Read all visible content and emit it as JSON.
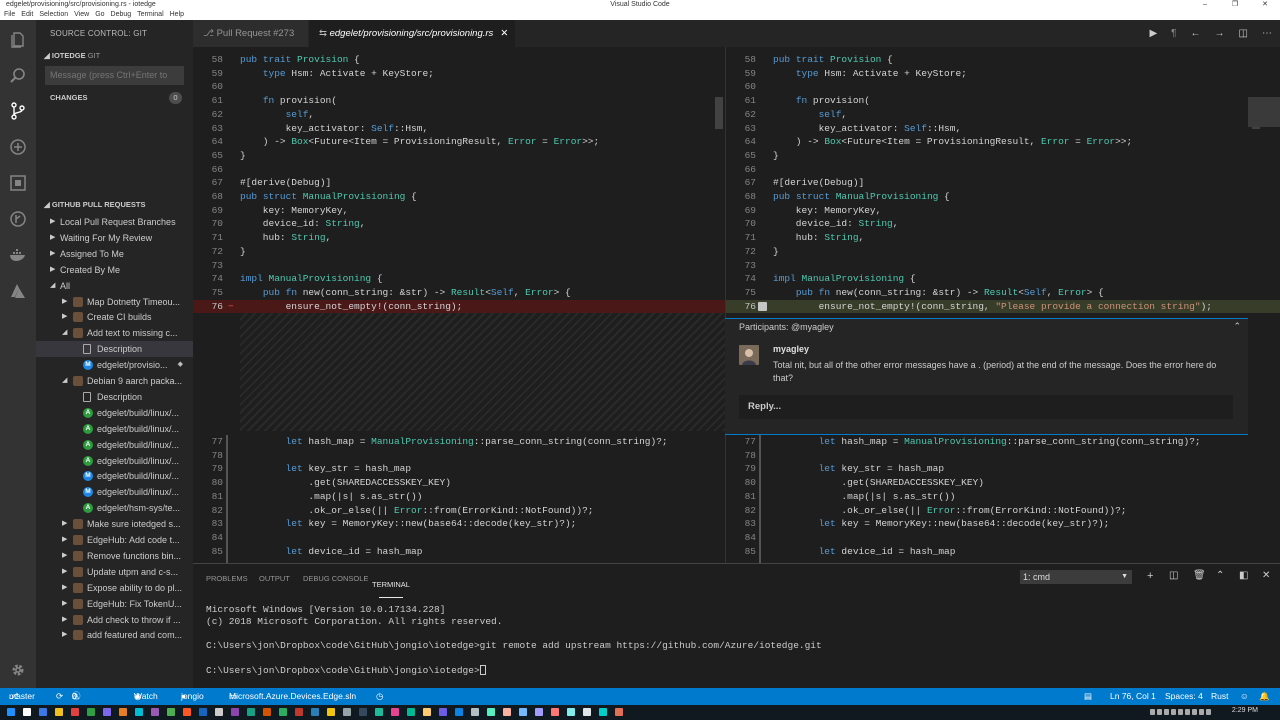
{
  "title_bar": {
    "path": "edgelet/provisioning/src/provisioning.rs - iotedge",
    "app": "Visual Studio Code",
    "controls": [
      "–",
      "❐",
      "✕"
    ]
  },
  "menu": [
    "File",
    "Edit",
    "Selection",
    "View",
    "Go",
    "Debug",
    "Terminal",
    "Help"
  ],
  "activity": [
    "files-icon",
    "search-icon",
    "source-control-icon",
    "debug-icon",
    "extensions-icon",
    "git-graph-icon",
    "docker-icon",
    "azure-icon",
    "settings-icon"
  ],
  "sidebar": {
    "title": "SOURCE CONTROL: GIT",
    "repo": "IOTEDGE",
    "repo_kind": "GIT",
    "message_placeholder": "Message (press Ctrl+Enter to",
    "changes_label": "CHANGES",
    "changes_count": "0",
    "pr_section": "GITHUB PULL REQUESTS",
    "tree": [
      {
        "label": "Local Pull Request Branches",
        "indent": 1,
        "tw": "▶"
      },
      {
        "label": "Waiting For My Review",
        "indent": 1,
        "tw": "▶"
      },
      {
        "label": "Assigned To Me",
        "indent": 1,
        "tw": "▶"
      },
      {
        "label": "Created By Me",
        "indent": 1,
        "tw": "▶"
      },
      {
        "label": "All",
        "indent": 1,
        "tw": "◢"
      },
      {
        "label": "Map Dotnetty Timeou...",
        "indent": 2,
        "tw": "▶",
        "icon": "av"
      },
      {
        "label": "Create CI builds",
        "indent": 2,
        "tw": "▶",
        "icon": "av"
      },
      {
        "label": "Add text to missing c...",
        "indent": 2,
        "tw": "◢",
        "icon": "av"
      },
      {
        "label": "Description",
        "indent": 3,
        "icon": "doc",
        "sel": true
      },
      {
        "label": "edgelet/provisio...",
        "indent": 3,
        "icon": "M",
        "dot": "◆"
      },
      {
        "label": "Debian 9 aarch packa...",
        "indent": 2,
        "tw": "◢",
        "icon": "av"
      },
      {
        "label": "Description",
        "indent": 3,
        "icon": "doc"
      },
      {
        "label": "edgelet/build/linux/...",
        "indent": 3,
        "icon": "A"
      },
      {
        "label": "edgelet/build/linux/...",
        "indent": 3,
        "icon": "A"
      },
      {
        "label": "edgelet/build/linux/...",
        "indent": 3,
        "icon": "A"
      },
      {
        "label": "edgelet/build/linux/...",
        "indent": 3,
        "icon": "A"
      },
      {
        "label": "edgelet/build/linux/...",
        "indent": 3,
        "icon": "M"
      },
      {
        "label": "edgelet/build/linux/...",
        "indent": 3,
        "icon": "M"
      },
      {
        "label": "edgelet/hsm-sys/te...",
        "indent": 3,
        "icon": "A"
      },
      {
        "label": "Make sure iotedged s...",
        "indent": 2,
        "tw": "▶",
        "icon": "av"
      },
      {
        "label": "EdgeHub: Add code t...",
        "indent": 2,
        "tw": "▶",
        "icon": "av"
      },
      {
        "label": "Remove functions bin...",
        "indent": 2,
        "tw": "▶",
        "icon": "av"
      },
      {
        "label": "Update utpm and c-s...",
        "indent": 2,
        "tw": "▶",
        "icon": "av"
      },
      {
        "label": "Expose ability to do pl...",
        "indent": 2,
        "tw": "▶",
        "icon": "av"
      },
      {
        "label": "EdgeHub: Fix TokenU...",
        "indent": 2,
        "tw": "▶",
        "icon": "av"
      },
      {
        "label": "Add check to throw if ...",
        "indent": 2,
        "tw": "▶",
        "icon": "av"
      },
      {
        "label": "add featured and com...",
        "indent": 2,
        "tw": "▶",
        "icon": "av"
      }
    ]
  },
  "tabs": [
    {
      "label": "Pull Request #273",
      "active": false
    },
    {
      "label": "edgelet/provisioning/src/provisioning.rs",
      "active": true,
      "close": "✕"
    }
  ],
  "editor_actions": [
    "▶",
    "¶",
    "←",
    "→",
    "◫",
    "⋯"
  ],
  "code_top": [
    {
      "n": "58",
      "t": "pub trait Provision {"
    },
    {
      "n": "59",
      "t": "    type Hsm: Activate + KeyStore;"
    },
    {
      "n": "60",
      "t": ""
    },
    {
      "n": "61",
      "t": "    fn provision("
    },
    {
      "n": "62",
      "t": "        self,"
    },
    {
      "n": "63",
      "t": "        key_activator: Self::Hsm,"
    },
    {
      "n": "64",
      "t": "    ) -> Box<Future<Item = ProvisioningResult, Error = Error>>;"
    },
    {
      "n": "65",
      "t": "}"
    },
    {
      "n": "66",
      "t": ""
    },
    {
      "n": "67",
      "t": "#[derive(Debug)]"
    },
    {
      "n": "68",
      "t": "pub struct ManualProvisioning {"
    },
    {
      "n": "69",
      "t": "    key: MemoryKey,"
    },
    {
      "n": "70",
      "t": "    device_id: String,"
    },
    {
      "n": "71",
      "t": "    hub: String,"
    },
    {
      "n": "72",
      "t": "}"
    },
    {
      "n": "73",
      "t": ""
    },
    {
      "n": "74",
      "t": "impl ManualProvisioning {"
    },
    {
      "n": "75",
      "t": "    pub fn new(conn_string: &str) -> Result<Self, Error> {"
    }
  ],
  "line76_left": "        ensure_not_empty!(conn_string);",
  "line76_right": "        ensure_not_empty!(conn_string, \"Please provide a connection string\");",
  "line76_num": "76",
  "code_bottom": [
    {
      "n": "77",
      "t": "        let hash_map = ManualProvisioning::parse_conn_string(conn_string)?;"
    },
    {
      "n": "78",
      "t": ""
    },
    {
      "n": "79",
      "t": "        let key_str = hash_map"
    },
    {
      "n": "80",
      "t": "            .get(SHAREDACCESSKEY_KEY)"
    },
    {
      "n": "81",
      "t": "            .map(|s| s.as_str())"
    },
    {
      "n": "82",
      "t": "            .ok_or_else(|| Error::from(ErrorKind::NotFound))?;"
    },
    {
      "n": "83",
      "t": "        let key = MemoryKey::new(base64::decode(key_str)?);"
    },
    {
      "n": "84",
      "t": ""
    },
    {
      "n": "85",
      "t": "        let device_id = hash_map"
    }
  ],
  "comment": {
    "participants": "Participants: @myagley",
    "author": "myagley",
    "text": "Total nit, but all of the other error messages have a  .  (period) at the end of the message. Does the error here do that?",
    "reply": "Reply..."
  },
  "panel": {
    "tabs": [
      "PROBLEMS",
      "OUTPUT",
      "DEBUG CONSOLE",
      "TERMINAL"
    ],
    "terminal_select": "1: cmd",
    "lines": [
      "Microsoft Windows [Version 10.0.17134.228]",
      "(c) 2018 Microsoft Corporation. All rights reserved.",
      "",
      "C:\\Users\\jon\\Dropbox\\code\\GitHub\\jongio\\iotedge>git remote add upstream https://github.com/Azure/iotedge.git",
      "",
      "C:\\Users\\jon\\Dropbox\\code\\GitHub\\jongio\\iotedge>"
    ]
  },
  "status": {
    "branch": "master",
    "sync": "⟳",
    "errors": "0",
    "warnings": "0",
    "watch": "Watch",
    "github": "jongio",
    "solution": "Microsoft.Azure.Devices.Edge.sln",
    "position": "Ln 76, Col 1",
    "spaces": "Spaces: 4",
    "lang": "Rust",
    "clock": "2:29 PM"
  }
}
